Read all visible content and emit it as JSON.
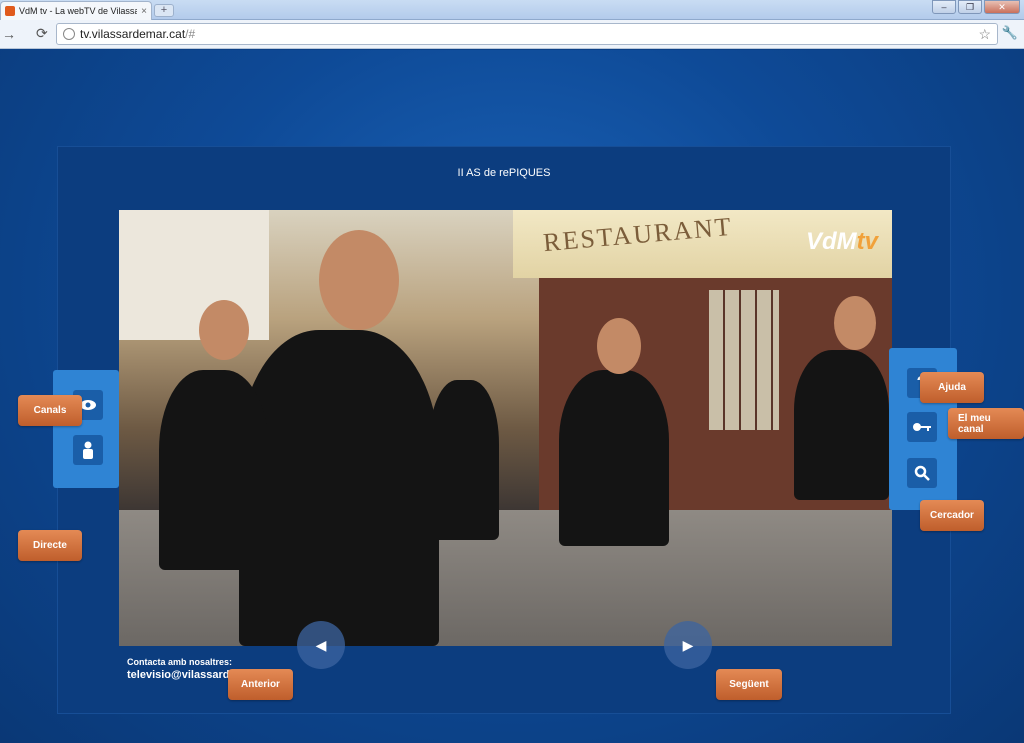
{
  "browser": {
    "tab_title": "VdM tv - La webTV de Vilassar",
    "tab_close": "×",
    "new_tab": "+",
    "url_host": "tv.vilassardemar.cat",
    "url_path": "/#",
    "window_buttons": [
      "–",
      "❐",
      "✕"
    ]
  },
  "video": {
    "title": "II AS de rePIQUES",
    "awning_text": "RESTAURANT",
    "logo_main": "VdM",
    "logo_tv": "tv"
  },
  "nav_left": {
    "canals_label": "Canals",
    "directe_label": "Directe"
  },
  "nav_right": {
    "ajuda_label": "Ajuda",
    "meu_canal_label": "El meu canal",
    "cercador_label": "Cercador",
    "question_glyph": "?"
  },
  "pager": {
    "prev_label": "Anterior",
    "next_label": "Següent"
  },
  "contact": {
    "heading": "Contacta amb nosaltres:",
    "email": "televisio@vilassardemar.cat"
  }
}
